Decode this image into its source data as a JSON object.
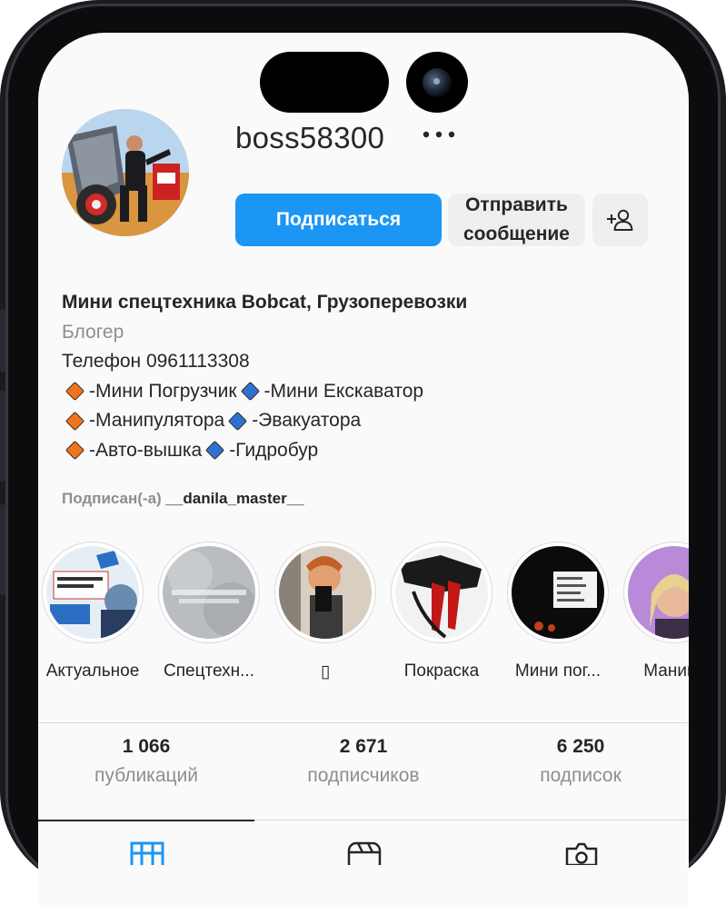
{
  "profile": {
    "username": "boss58300",
    "follow_label": "Подписаться",
    "message_label": "Отправить\nсообщение",
    "display_name": "Мини спецтехника Bobcat, Грузоперевозки",
    "category": "Блогер",
    "phone": "Телефон 0961113308",
    "services": [
      [
        "-Мини Погрузчик",
        "-Мини Екскаватор"
      ],
      [
        "-Манипулятора",
        "-Эвакуатора"
      ],
      [
        "-Авто-вышка",
        "-Гидробур"
      ]
    ],
    "followed_by_prefix": "Подписан(-а)",
    "followed_by_user": "__danila_master__"
  },
  "highlights": [
    {
      "label": "Актуальное"
    },
    {
      "label": "Спецтехн..."
    },
    {
      "label": "▯"
    },
    {
      "label": "Покраска"
    },
    {
      "label": "Мини пог..."
    },
    {
      "label": "Манипу"
    }
  ],
  "stats": {
    "posts_count": "1 066",
    "posts_label": "публикаций",
    "followers_count": "2 671",
    "followers_label": "подписчиков",
    "following_count": "6 250",
    "following_label": "подписок"
  },
  "colors": {
    "accent": "#1c96f5",
    "diamond_orange": "#f0741e",
    "diamond_blue": "#2d72d2"
  },
  "icons": [
    "more-icon",
    "add-user-icon",
    "grid-icon",
    "reels-icon",
    "tagged-icon"
  ]
}
